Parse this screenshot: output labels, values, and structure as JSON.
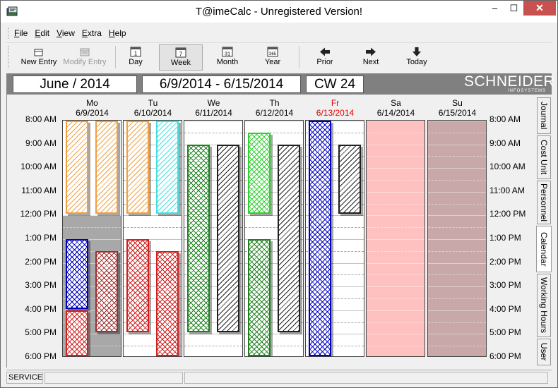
{
  "window": {
    "title": "T@imeCalc - Unregistered Version!",
    "minimize": "–",
    "maximize": "☐",
    "close": "✕"
  },
  "menu": [
    {
      "label": "File",
      "key": "F",
      "rest": "ile"
    },
    {
      "label": "Edit",
      "key": "E",
      "rest": "dit"
    },
    {
      "label": "View",
      "key": "V",
      "rest": "iew"
    },
    {
      "label": "Extra",
      "key": "E",
      "rest": "xtra"
    },
    {
      "label": "Help",
      "key": "H",
      "rest": "elp"
    }
  ],
  "toolbar": {
    "new_entry": "New Entry",
    "modify_entry": "Modify Entry",
    "day": "Day",
    "week": "Week",
    "month": "Month",
    "year": "Year",
    "prior": "Prior",
    "next": "Next",
    "today": "Today",
    "week_icon_num": "7",
    "month_icon_num": "31",
    "year_icon_num": "365",
    "day_icon_num": "1"
  },
  "header": {
    "month": "June / 2014",
    "range": "6/9/2014 - 6/15/2014",
    "cw": "CW 24",
    "brand": "SCHNEIDER",
    "brand_sub": "INFOSYSTEMS"
  },
  "times": [
    "8:00 AM",
    "9:00 AM",
    "10:00 AM",
    "11:00 AM",
    "12:00 PM",
    "1:00 PM",
    "2:00 PM",
    "3:00 PM",
    "4:00 PM",
    "5:00 PM",
    "6:00 PM"
  ],
  "days": [
    {
      "name": "Mo",
      "date": "6/9/2014",
      "today": false,
      "bg": "#a8a8a8"
    },
    {
      "name": "Tu",
      "date": "6/10/2014",
      "today": false,
      "bg": "#ffffff"
    },
    {
      "name": "We",
      "date": "6/11/2014",
      "today": false,
      "bg": "#ffffff"
    },
    {
      "name": "Th",
      "date": "6/12/2014",
      "today": false,
      "bg": "#ffffff"
    },
    {
      "name": "Fr",
      "date": "6/13/2014",
      "today": true,
      "bg": "#ffffff"
    },
    {
      "name": "Sa",
      "date": "6/14/2014",
      "today": false,
      "bg": "#ffc0c0"
    },
    {
      "name": "Su",
      "date": "6/15/2014",
      "today": false,
      "bg": "#c8a8a8"
    }
  ],
  "appointments": [
    {
      "day": 0,
      "lane": 0,
      "start": 8.0,
      "end": 12.0,
      "color": "#f0a040",
      "pattern": "diag"
    },
    {
      "day": 0,
      "lane": 1,
      "start": 8.0,
      "end": 12.0,
      "color": "#f0a040",
      "pattern": "diag"
    },
    {
      "day": 0,
      "lane": 0,
      "start": 13.0,
      "end": 16.0,
      "color": "#0000c0",
      "pattern": "cross"
    },
    {
      "day": 0,
      "lane": 0,
      "start": 16.0,
      "end": 18.0,
      "color": "#d02020",
      "pattern": "cross"
    },
    {
      "day": 0,
      "lane": 1,
      "start": 13.5,
      "end": 17.0,
      "color": "#a03030",
      "pattern": "cross"
    },
    {
      "day": 1,
      "lane": 0,
      "start": 8.0,
      "end": 12.0,
      "color": "#f0a040",
      "pattern": "diag"
    },
    {
      "day": 1,
      "lane": 1,
      "start": 8.0,
      "end": 12.0,
      "color": "#40e0e0",
      "pattern": "diag"
    },
    {
      "day": 1,
      "lane": 0,
      "start": 13.0,
      "end": 17.0,
      "color": "#d02020",
      "pattern": "cross"
    },
    {
      "day": 1,
      "lane": 1,
      "start": 13.5,
      "end": 18.0,
      "color": "#d02020",
      "pattern": "cross"
    },
    {
      "day": 2,
      "lane": 0,
      "start": 9.0,
      "end": 17.0,
      "color": "#208020",
      "pattern": "cross"
    },
    {
      "day": 2,
      "lane": 1,
      "start": 9.0,
      "end": 17.0,
      "color": "#202020",
      "pattern": "diag"
    },
    {
      "day": 3,
      "lane": 0,
      "start": 8.5,
      "end": 12.0,
      "color": "#30d030",
      "pattern": "cross"
    },
    {
      "day": 3,
      "lane": 0,
      "start": 13.0,
      "end": 18.0,
      "color": "#208020",
      "pattern": "cross"
    },
    {
      "day": 3,
      "lane": 1,
      "start": 9.0,
      "end": 17.0,
      "color": "#202020",
      "pattern": "diag"
    },
    {
      "day": 4,
      "lane": 0,
      "start": 8.0,
      "end": 18.0,
      "color": "#0000c0",
      "pattern": "cross"
    },
    {
      "day": 4,
      "lane": 1,
      "start": 9.0,
      "end": 12.0,
      "color": "#202020",
      "pattern": "diag"
    }
  ],
  "side_tabs": [
    "Journal",
    "Cost Unit",
    "Personnel",
    "Calendar",
    "Working Hours",
    "User"
  ],
  "active_side_tab": "Calendar",
  "status": {
    "user": "SERVICE"
  }
}
